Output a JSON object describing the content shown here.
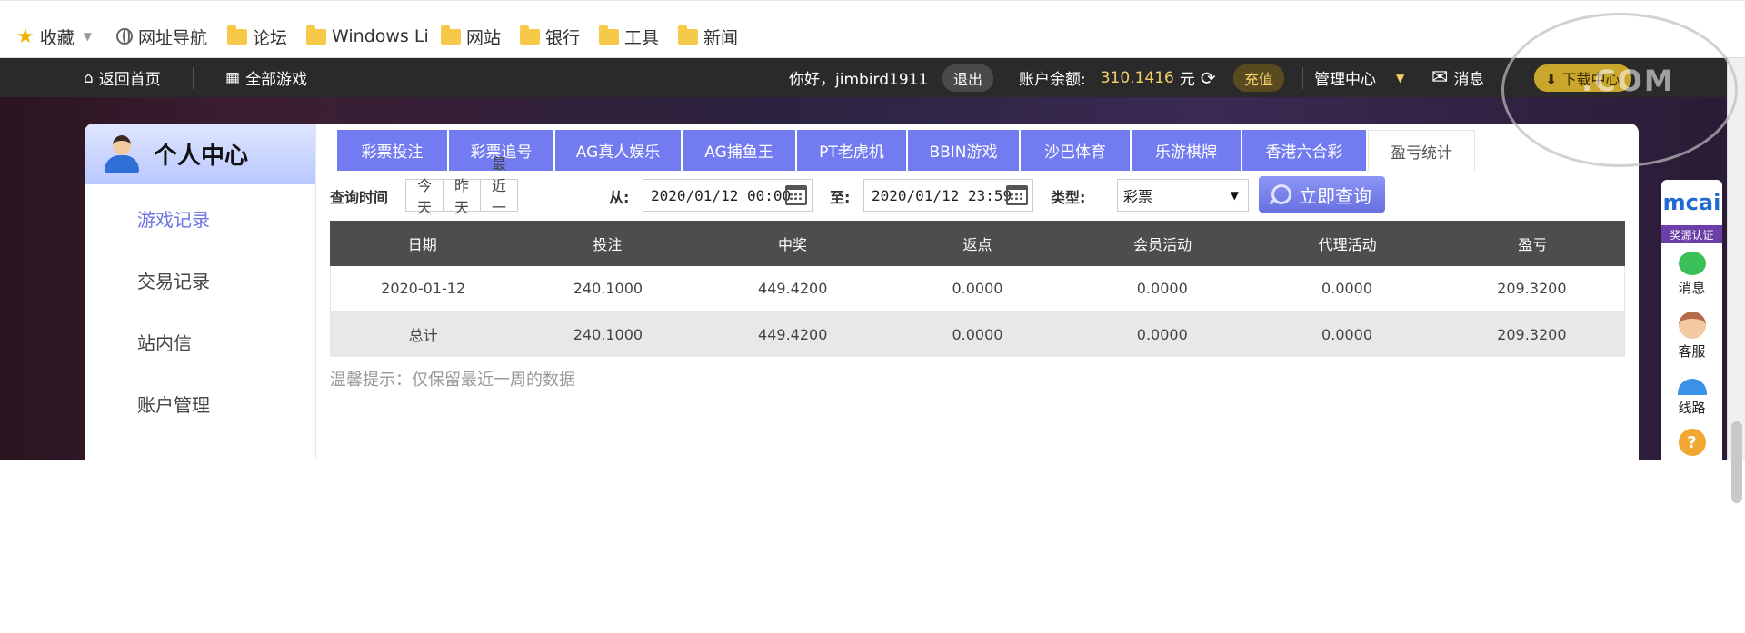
{
  "bookmarks": {
    "favorites": "收藏",
    "nav": "网址导航",
    "folders": [
      "论坛",
      "Windows Li",
      "网站",
      "银行",
      "工具",
      "新闻"
    ]
  },
  "topnav": {
    "home": "返回首页",
    "all_games": "全部游戏",
    "greeting": "你好，jimbird1911",
    "logout": "退出",
    "balance_label": "账户余额:",
    "balance_value": "310.1416",
    "currency": "元",
    "recharge": "充值",
    "admin": "管理中心",
    "messages": "消息",
    "download": "下载中心"
  },
  "sidebar": {
    "title": "个人中心",
    "items": [
      "游戏记录",
      "交易记录",
      "站内信",
      "账户管理"
    ]
  },
  "tabs": [
    "彩票投注",
    "彩票追号",
    "AG真人娱乐",
    "AG捕鱼王",
    "PT老虎机",
    "BBIN游戏",
    "沙巴体育",
    "乐游棋牌",
    "香港六合彩",
    "盈亏统计"
  ],
  "query": {
    "time_label": "查询时间",
    "quick": [
      "今天",
      "昨天",
      "最近一周"
    ],
    "from_label": "从:",
    "from_value": "2020/01/12 00:00",
    "to_label": "至:",
    "to_value": "2020/01/12 23:59",
    "type_label": "类型:",
    "type_value": "彩票",
    "submit": "立即查询"
  },
  "table": {
    "headers": [
      "日期",
      "投注",
      "中奖",
      "返点",
      "会员活动",
      "代理活动",
      "盈亏"
    ],
    "rows": [
      [
        "2020-01-12",
        "240.1000",
        "449.4200",
        "0.0000",
        "0.0000",
        "0.0000",
        "209.3200"
      ],
      [
        "总计",
        "240.1000",
        "449.4200",
        "0.0000",
        "0.0000",
        "0.0000",
        "209.3200"
      ]
    ]
  },
  "hint": "温馨提示：仅保留最近一周的数据",
  "float_panel": {
    "logo": "mcai",
    "badge": "奖源认证",
    "items": [
      "消息",
      "客服",
      "线路"
    ]
  },
  "watermark": ".COM"
}
